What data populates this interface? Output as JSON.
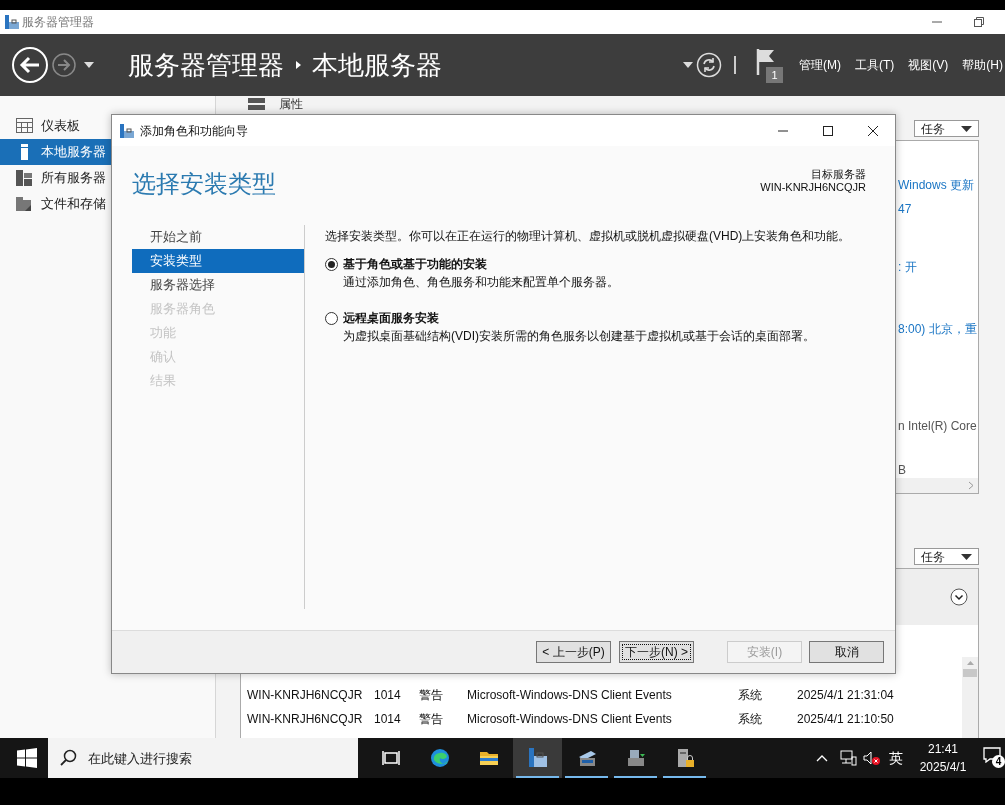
{
  "window": {
    "title": "服务器管理器"
  },
  "header": {
    "breadcrumb": [
      "服务器管理器",
      "本地服务器"
    ],
    "flag_count": "1",
    "menus": [
      "管理(M)",
      "工具(T)",
      "视图(V)",
      "帮助(H)"
    ]
  },
  "sidebar": {
    "items": [
      {
        "label": "仪表板",
        "kind": "dashboard",
        "selected": false
      },
      {
        "label": "本地服务器",
        "kind": "local",
        "selected": true
      },
      {
        "label": "所有服务器",
        "kind": "all",
        "selected": false
      },
      {
        "label": "文件和存储",
        "kind": "files",
        "selected": false
      }
    ]
  },
  "properties": {
    "title": "属性",
    "tasks_button": "任务",
    "values": [
      {
        "text": "Windows 更新",
        "kind": "link"
      },
      {
        "text": "47",
        "kind": "link"
      },
      {
        "text": ": 开",
        "kind": "link"
      },
      {
        "text": "8:00) 北京，重",
        "kind": "link"
      },
      {
        "text": "n Intel(R) Core",
        "kind": "text"
      },
      {
        "text": "B",
        "kind": "text"
      }
    ]
  },
  "events": {
    "tasks_button": "任务",
    "rows": [
      [
        "WIN-KNRJH6NCQJR",
        "1014",
        "警告",
        "Microsoft-Windows-DNS Client Events",
        "系统",
        "2025/4/1 21:31:04"
      ],
      [
        "WIN-KNRJH6NCQJR",
        "1014",
        "警告",
        "Microsoft-Windows-DNS Client Events",
        "系统",
        "2025/4/1 21:10:50"
      ]
    ]
  },
  "dialog": {
    "title": "添加角色和功能向导",
    "heading": "选择安装类型",
    "target_label": "目标服务器",
    "target_name": "WIN-KNRJH6NCQJR",
    "steps": [
      {
        "label": "开始之前",
        "selected": false,
        "disabled": false
      },
      {
        "label": "安装类型",
        "selected": true,
        "disabled": false
      },
      {
        "label": "服务器选择",
        "selected": false,
        "disabled": false
      },
      {
        "label": "服务器角色",
        "selected": false,
        "disabled": true
      },
      {
        "label": "功能",
        "selected": false,
        "disabled": true
      },
      {
        "label": "确认",
        "selected": false,
        "disabled": true
      },
      {
        "label": "结果",
        "selected": false,
        "disabled": true
      }
    ],
    "intro": "选择安装类型。你可以在正在运行的物理计算机、虚拟机或脱机虚拟硬盘(VHD)上安装角色和功能。",
    "options": [
      {
        "title": "基于角色或基于功能的安装",
        "description": "通过添加角色、角色服务和功能来配置单个服务器。",
        "selected": true
      },
      {
        "title": "远程桌面服务安装",
        "description": "为虚拟桌面基础结构(VDI)安装所需的角色服务以创建基于虚拟机或基于会话的桌面部署。",
        "selected": false
      }
    ],
    "buttons": [
      {
        "label": "< 上一步(P)",
        "disabled": false,
        "focused": false
      },
      {
        "label": "下一步(N) >",
        "disabled": false,
        "focused": true
      },
      {
        "label": "安装(I)",
        "disabled": true,
        "focused": false
      },
      {
        "label": "取消",
        "disabled": false,
        "focused": false
      }
    ]
  },
  "taskbar": {
    "search_placeholder": "在此键入进行搜索",
    "apps": [
      {
        "kind": "taskview",
        "running": false,
        "selected": false
      },
      {
        "kind": "browser",
        "running": false,
        "selected": false
      },
      {
        "kind": "folder",
        "running": false,
        "selected": false
      },
      {
        "kind": "servermanager",
        "running": true,
        "selected": true
      },
      {
        "kind": "monitor",
        "running": true,
        "selected": false
      },
      {
        "kind": "installer",
        "running": true,
        "selected": false
      },
      {
        "kind": "lockedserver",
        "running": true,
        "selected": false
      }
    ],
    "language": "英",
    "time": "21:41",
    "date": "2025/4/1",
    "notifications": "4"
  }
}
